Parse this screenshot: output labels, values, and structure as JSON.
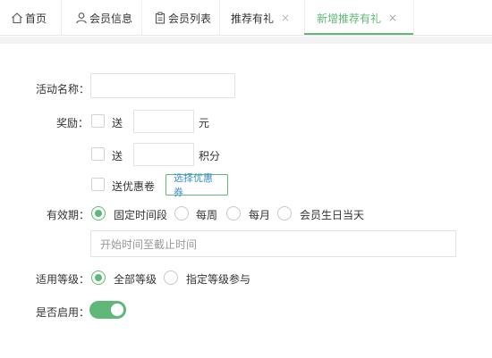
{
  "tabs": [
    {
      "label": "首页",
      "icon": "home-icon"
    },
    {
      "label": "会员信息",
      "icon": "user-icon"
    },
    {
      "label": "会员列表",
      "icon": "clipboard-icon"
    },
    {
      "label": "推荐有礼",
      "close": "×"
    },
    {
      "label": "新增推荐有礼",
      "close": "×",
      "active": true
    }
  ],
  "form": {
    "activity_name": {
      "label": "活动名称：",
      "value": ""
    },
    "reward": {
      "label": "奖励：",
      "options": [
        {
          "prefix": "送",
          "value": "",
          "suffix": "元"
        },
        {
          "prefix": "送",
          "value": "",
          "suffix": "积分"
        },
        {
          "prefix": "送优惠卷",
          "button": "选择优惠券"
        }
      ]
    },
    "validity": {
      "label": "有效期：",
      "options": [
        "固定时间段",
        "每周",
        "每月",
        "会员生日当天"
      ],
      "selected": "固定时间段",
      "date_placeholder": "开始时间至截止时间"
    },
    "level": {
      "label": "适用等级：",
      "options": [
        "全部等级",
        "指定等级参与"
      ],
      "selected": "全部等级"
    },
    "enabled": {
      "label": "是否启用：",
      "value": true
    }
  },
  "colors": {
    "accent": "#5fb878",
    "link": "#3d8fc9"
  }
}
